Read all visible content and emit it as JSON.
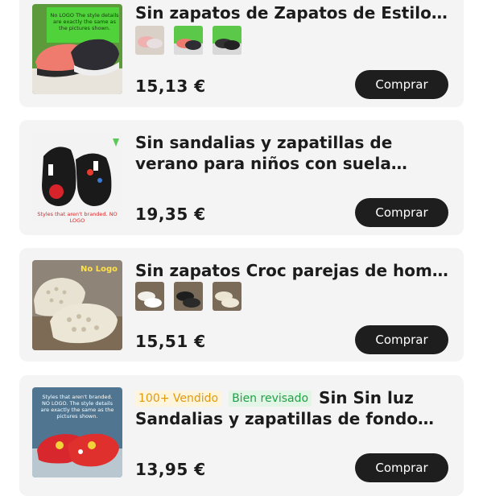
{
  "products": [
    {
      "title": "Sin zapatos de Zapatos de Estilo de...",
      "price": "15,13 €",
      "buy_label": "Comprar",
      "thumb_caption": "No LOGO The style details are exactly the same as the pictures shown."
    },
    {
      "title": "Sin sandalias y zapatillas de verano para niños con suela blanda para ho...",
      "price": "19,35 €",
      "buy_label": "Comprar",
      "thumb_caption": "Styles that aren't branded. NO LOGO"
    },
    {
      "title": "Sin zapatos Croc parejas de hombre...",
      "price": "15,51 €",
      "buy_label": "Comprar",
      "thumb_caption": "No Logo"
    },
    {
      "badge_sold": "100+ Vendido",
      "badge_reviewed": "Bien revisado",
      "title": "Sin Sin luz Sandalias y zapatillas de fondo suav...",
      "price": "13,95 €",
      "buy_label": "Comprar",
      "thumb_caption": "Styles that aren't branded. NO LOGO. The style details are exactly the same as the pictures shown."
    }
  ],
  "colors": {
    "card_bg": "#f4f4f4",
    "button_bg": "#1e1e1e",
    "badge_sold": "#e09a12",
    "badge_reviewed": "#21a146"
  }
}
